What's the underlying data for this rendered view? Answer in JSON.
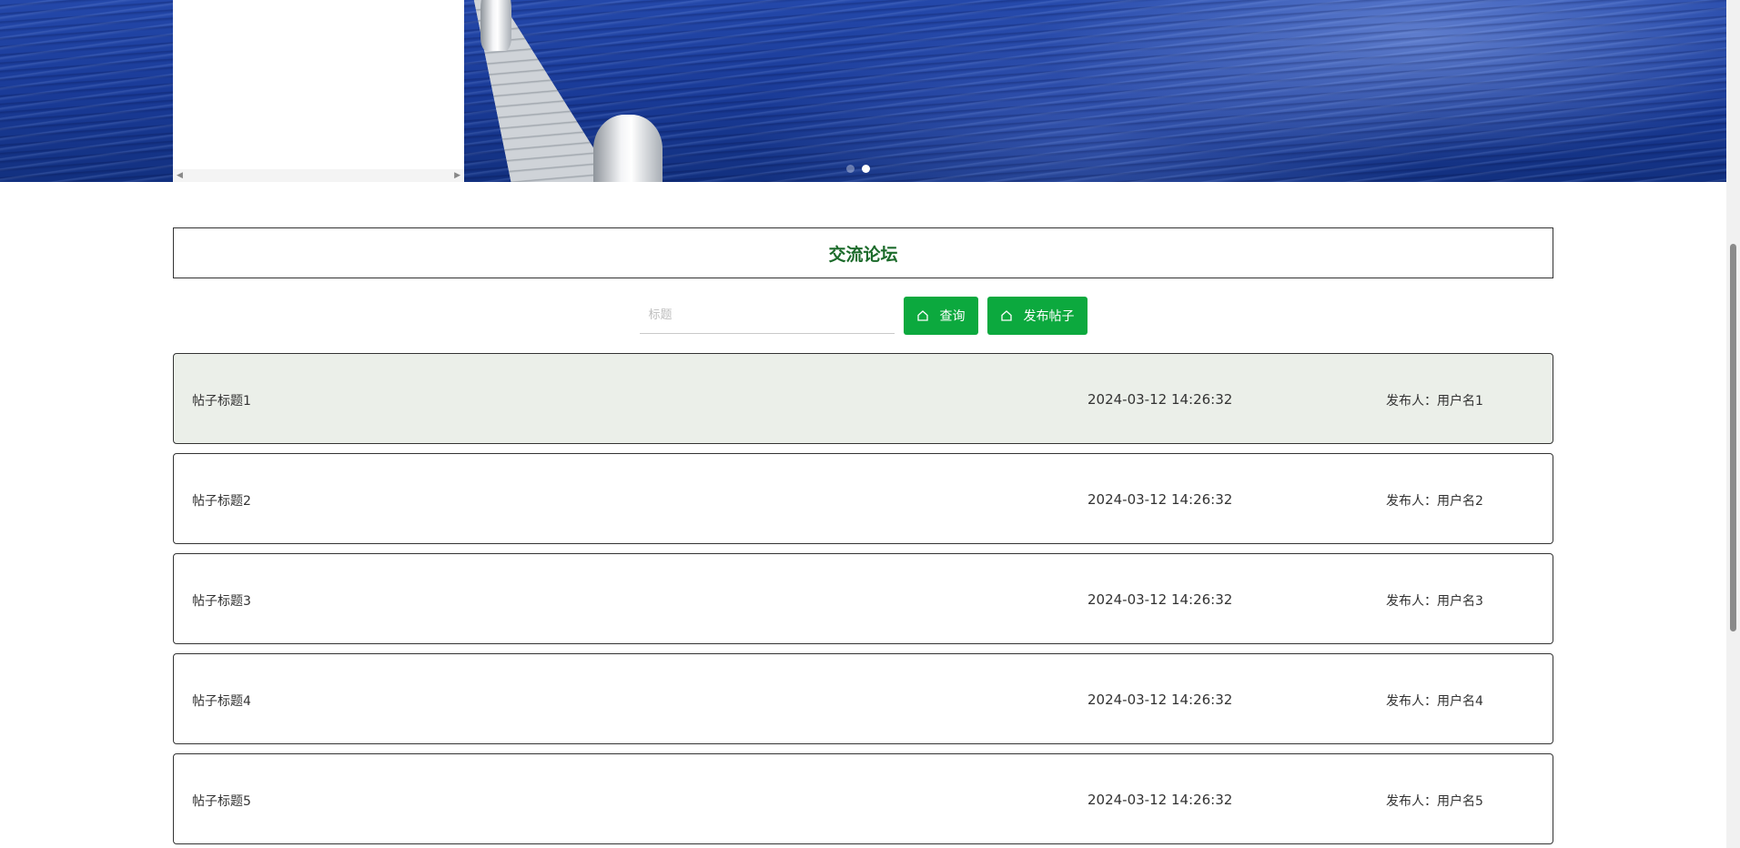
{
  "banner": {
    "carousel_dot_count": 2,
    "active_dot": 2,
    "scroll_left_glyph": "◀",
    "scroll_right_glyph": "▶"
  },
  "forum": {
    "title": "交流论坛",
    "search": {
      "placeholder": "标题",
      "value": ""
    },
    "buttons": {
      "query_label": "查询",
      "publish_label": "发布帖子",
      "icon": "home-icon"
    },
    "author_prefix": "发布人：",
    "posts": [
      {
        "title": "帖子标题1",
        "time": "2024-03-12 14:26:32",
        "author": "发布人：用户名1"
      },
      {
        "title": "帖子标题2",
        "time": "2024-03-12 14:26:32",
        "author": "发布人：用户名2"
      },
      {
        "title": "帖子标题3",
        "time": "2024-03-12 14:26:32",
        "author": "发布人：用户名3"
      },
      {
        "title": "帖子标题4",
        "time": "2024-03-12 14:26:32",
        "author": "发布人：用户名4"
      },
      {
        "title": "帖子标题5",
        "time": "2024-03-12 14:26:32",
        "author": "发布人：用户名5"
      }
    ]
  },
  "colors": {
    "accent_green": "#0ca93e",
    "title_green": "#1c6b2b",
    "hover_row": "#ebefe9"
  }
}
